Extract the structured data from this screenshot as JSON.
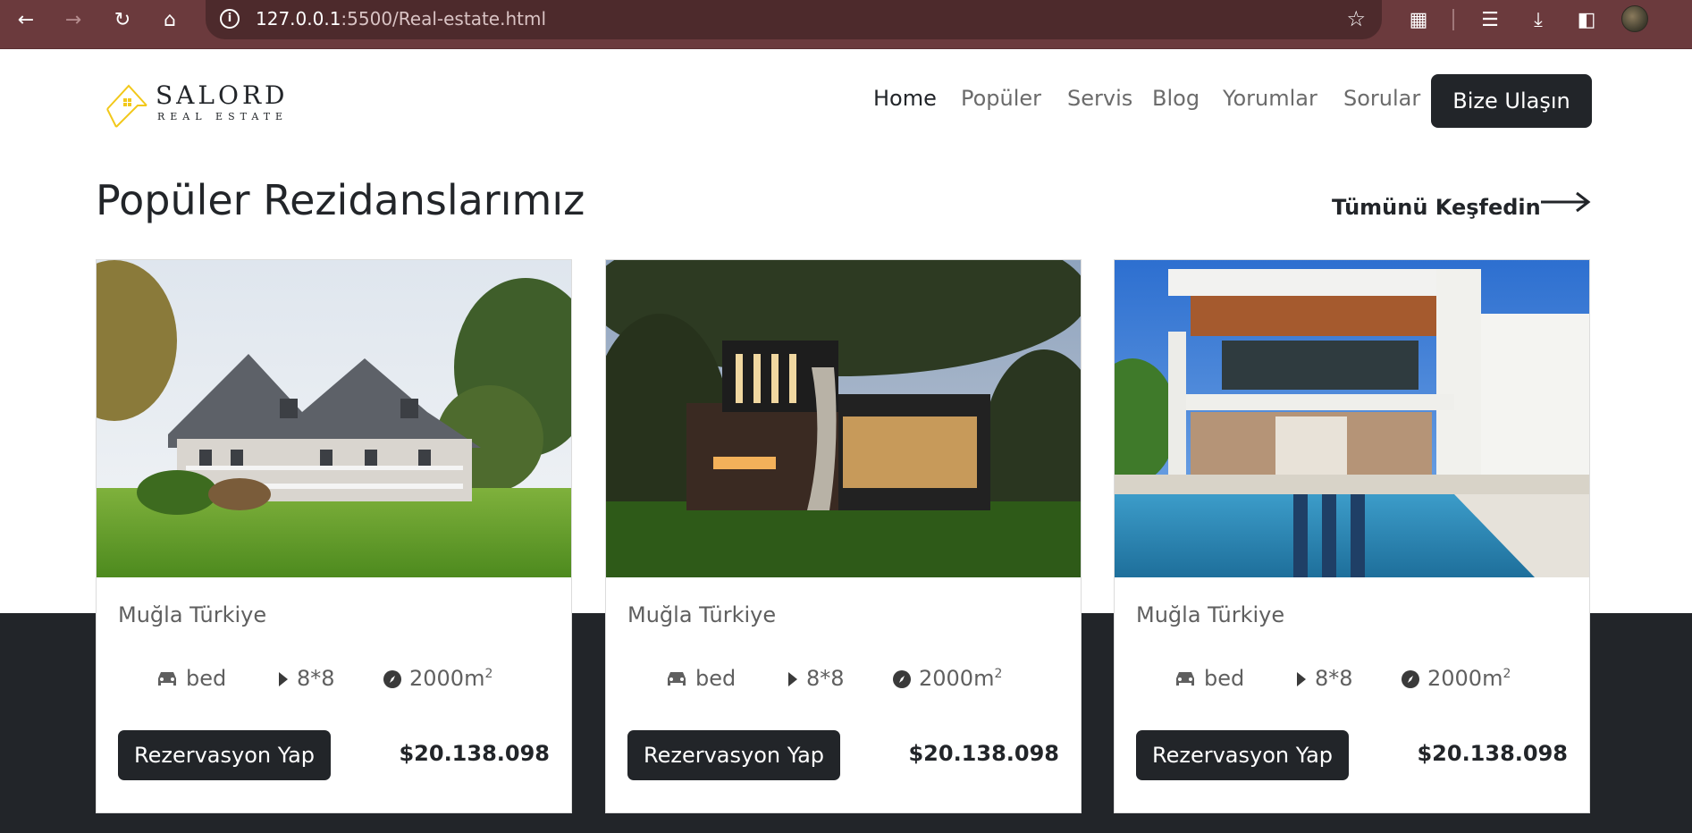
{
  "browser": {
    "url_host": "127.0.0.1",
    "url_rest": ":5500/Real-estate.html"
  },
  "logo": {
    "brand": "SALORD",
    "sub": "REAL ESTATE"
  },
  "nav": {
    "items": [
      "Home",
      "Popüler",
      "Servis",
      "Blog",
      "Yorumlar",
      "Sorular"
    ],
    "cta": "Bize Ulaşın"
  },
  "section": {
    "title": "Popüler Rezidanslarımız",
    "explore": "Tümünü Keşfedin"
  },
  "cards": [
    {
      "location": "Muğla Türkiye",
      "bed": "bed",
      "size": "8*8",
      "area": "2000m",
      "area_sup": "2",
      "button": "Rezervasyon Yap",
      "price": "$20.138.098"
    },
    {
      "location": "Muğla Türkiye",
      "bed": "bed",
      "size": "8*8",
      "area": "2000m",
      "area_sup": "2",
      "button": "Rezervasyon Yap",
      "price": "$20.138.098"
    },
    {
      "location": "Muğla Türkiye",
      "bed": "bed",
      "size": "8*8",
      "area": "2000m",
      "area_sup": "2",
      "button": "Rezervasyon Yap",
      "price": "$20.138.098"
    }
  ],
  "icons": {
    "back": "back-arrow-icon",
    "forward": "forward-arrow-icon",
    "reload": "reload-icon",
    "home": "home-icon",
    "bed": "car-icon",
    "size": "play-icon",
    "area": "compass-icon"
  },
  "colors": {
    "chrome": "#6b3a3d",
    "dark": "#222529",
    "logo_accent": "#f2c81a"
  }
}
